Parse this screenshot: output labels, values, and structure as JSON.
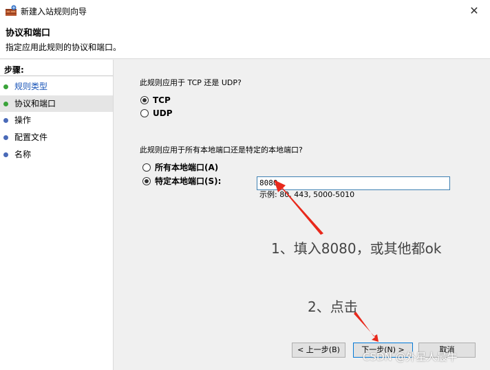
{
  "window": {
    "title": "新建入站规则向导",
    "close_glyph": "✕"
  },
  "header": {
    "title": "协议和端口",
    "subtitle": "指定应用此规则的协议和端口。"
  },
  "sidebar": {
    "heading": "步骤:",
    "items": [
      {
        "label": "规则类型",
        "state": "done"
      },
      {
        "label": "协议和端口",
        "state": "active"
      },
      {
        "label": "操作",
        "state": "pending"
      },
      {
        "label": "配置文件",
        "state": "pending"
      },
      {
        "label": "名称",
        "state": "pending"
      }
    ]
  },
  "main": {
    "protocol_question": "此规则应用于 TCP 还是 UDP?",
    "protocol_options": [
      {
        "label": "TCP",
        "checked": true
      },
      {
        "label": "UDP",
        "checked": false
      }
    ],
    "port_question": "此规则应用于所有本地端口还是特定的本地端口?",
    "port_options": [
      {
        "label": "所有本地端口(A)",
        "checked": false
      },
      {
        "label": "特定本地端口(S):",
        "checked": true
      }
    ],
    "port_value": "8080",
    "port_example": "示例: 80, 443, 5000-5010"
  },
  "annotations": {
    "step1": "1、填入8080，或其他都ok",
    "step2": "2、点击"
  },
  "buttons": {
    "back": "< 上一步(B)",
    "next": "下一步(N) >",
    "cancel": "取消"
  },
  "watermark": "CSDN @外星人最牛",
  "colors": {
    "arrow": "#e8291c",
    "step_done_dot": "#3aa33a",
    "step_pending_dot": "#4a6ab8",
    "input_border": "#3c7fb1"
  }
}
